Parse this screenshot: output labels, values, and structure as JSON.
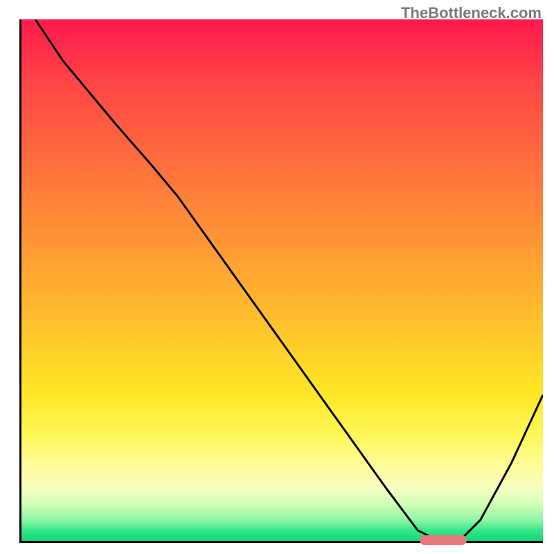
{
  "watermark": "TheBottleneck.com",
  "chart_data": {
    "type": "line",
    "title": "",
    "xlabel": "",
    "ylabel": "",
    "xlim": [
      0,
      100
    ],
    "ylim": [
      0,
      100
    ],
    "x": [
      0,
      8,
      18,
      25,
      30,
      40,
      50,
      60,
      70,
      76,
      80,
      84,
      88,
      94,
      100
    ],
    "values": [
      104,
      92,
      80,
      72,
      66,
      52,
      38,
      24,
      10,
      2,
      0,
      0,
      4,
      15,
      28
    ],
    "marker": {
      "x_start": 76,
      "x_end": 85,
      "y": 0.5
    },
    "gradient_stops": [
      {
        "pos": 0,
        "color": "#ff1a4d"
      },
      {
        "pos": 50,
        "color": "#ffb030"
      },
      {
        "pos": 80,
        "color": "#fff85a"
      },
      {
        "pos": 100,
        "color": "#10d878"
      }
    ]
  }
}
